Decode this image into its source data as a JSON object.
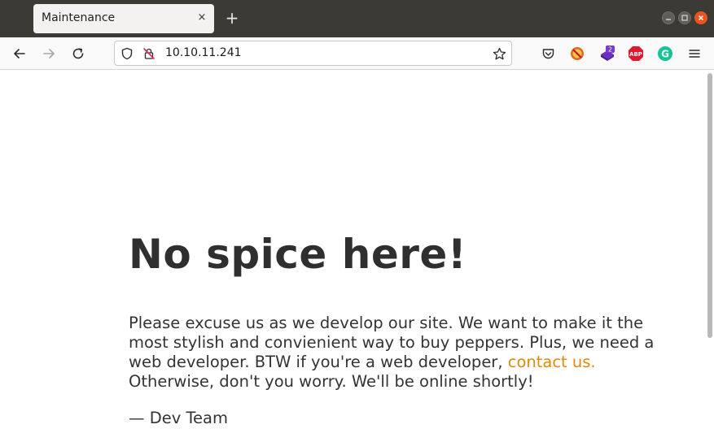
{
  "browser": {
    "tab_title": "Maintenance",
    "tab_close": "×",
    "new_tab": "+",
    "url": "10.10.11.241",
    "extension_badge_count": "2",
    "abp_label": "ABP",
    "grammarly_label": "G"
  },
  "page": {
    "heading": "No spice here!",
    "paragraph_before_link": "Please excuse us as we develop our site. We want to make it the most stylish and convienient way to buy peppers. Plus, we need a web developer. BTW if you're a web developer, ",
    "link_text": "contact us.",
    "paragraph_after_link": " Otherwise, don't you worry. We'll be online shortly!",
    "signature": "— Dev Team",
    "link_color": "#de8a0d"
  }
}
